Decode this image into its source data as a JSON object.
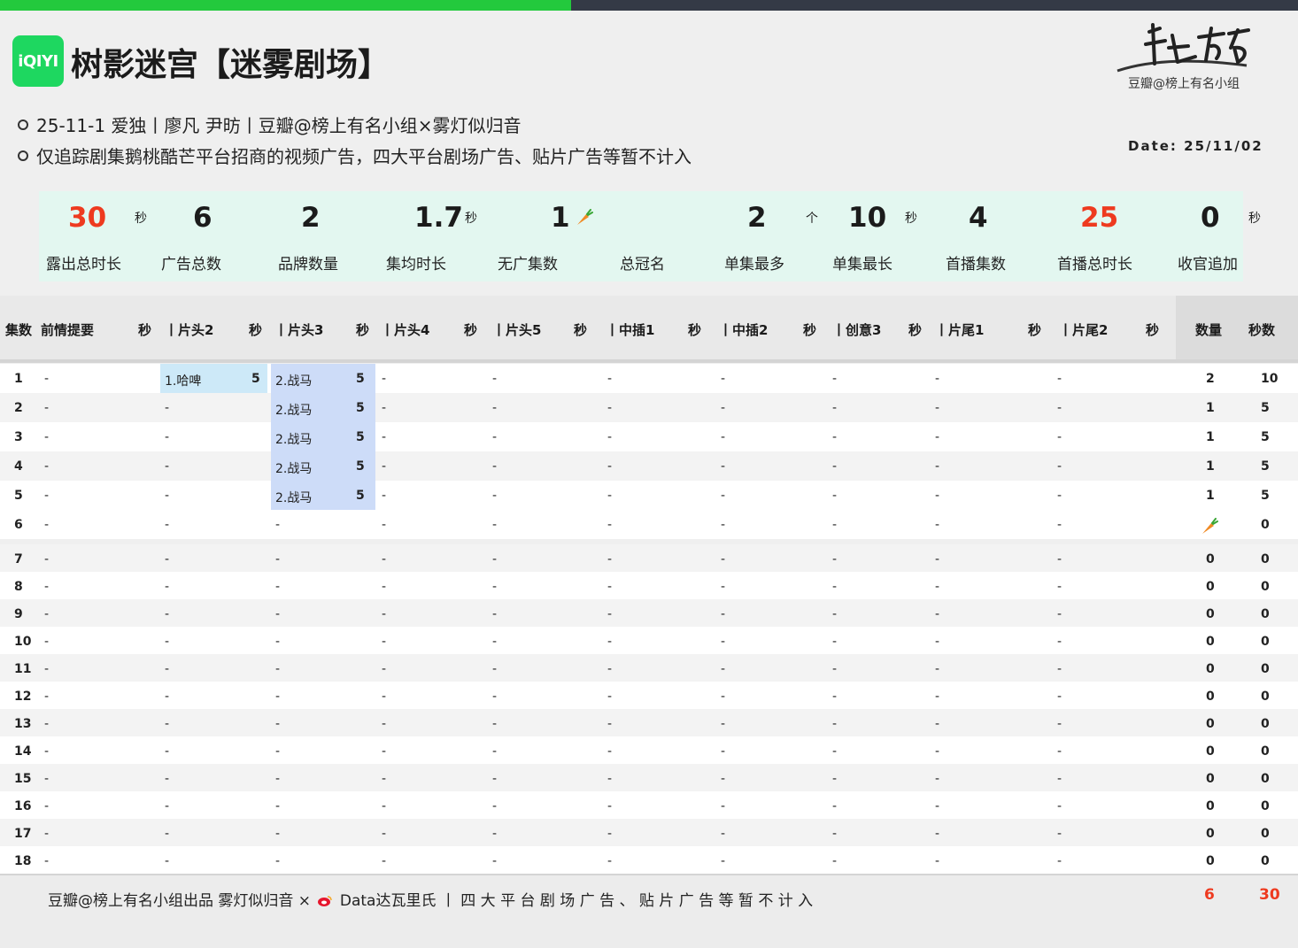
{
  "header": {
    "logo_text": "iQIYI",
    "title": "树影迷宫【迷雾剧场】",
    "brand_sub": "豆瓣@榜上有名小组",
    "bullets": [
      "25-11-1 爱独丨廖凡 尹昉丨豆瓣@榜上有名小组×雾灯似归音",
      "仅追踪剧集鹅桃酷芒平台招商的视频广告，四大平台剧场广告、贴片广告等暂不计入"
    ],
    "date": "Date: 25/11/02"
  },
  "colors": {
    "accent_green": "#23c93d",
    "highlight_red": "#ee3a1f",
    "stats_bg": "#e3f7f0"
  },
  "stats": [
    {
      "value": "30",
      "unit": "秒",
      "label": "露出总时长",
      "red": true
    },
    {
      "value": "6",
      "unit": "",
      "label": "广告总数"
    },
    {
      "value": "2",
      "unit": "",
      "label": "品牌数量"
    },
    {
      "value": "1.7",
      "unit": "秒",
      "label": "集均时长"
    },
    {
      "value": "1",
      "unit": "",
      "label": "无广集数",
      "icon": "carrot-icon"
    },
    {
      "value": "",
      "unit": "",
      "label": "总冠名"
    },
    {
      "value": "2",
      "unit": "个",
      "label": "单集最多"
    },
    {
      "value": "10",
      "unit": "秒",
      "label": "单集最长"
    },
    {
      "value": "4",
      "unit": "",
      "label": "首播集数"
    },
    {
      "value": "25",
      "unit": "",
      "label": "首播总时长",
      "red": true
    },
    {
      "value": "0",
      "unit": "秒",
      "label": "收官追加"
    }
  ],
  "table": {
    "headers": [
      "集数",
      "前情提要",
      "秒",
      "丨片头2",
      "秒",
      "丨片头3",
      "秒",
      "丨片头4",
      "秒",
      "丨片头5",
      "秒",
      "丨中插1",
      "秒",
      "丨中插2",
      "秒",
      "丨创意3",
      "秒",
      "丨片尾1",
      "秒",
      "丨片尾2",
      "秒",
      "数量",
      "秒数"
    ],
    "dash": "-",
    "rows": [
      {
        "ep": "1",
        "t2": "1.哈啤",
        "t2s": "5",
        "t3": "2.战马",
        "t3s": "5",
        "count": "2",
        "secs": "10"
      },
      {
        "ep": "2",
        "t2": "-",
        "t2s": "",
        "t3": "2.战马",
        "t3s": "5",
        "count": "1",
        "secs": "5"
      },
      {
        "ep": "3",
        "t2": "-",
        "t2s": "",
        "t3": "2.战马",
        "t3s": "5",
        "count": "1",
        "secs": "5"
      },
      {
        "ep": "4",
        "t2": "-",
        "t2s": "",
        "t3": "2.战马",
        "t3s": "5",
        "count": "1",
        "secs": "5"
      },
      {
        "ep": "5",
        "t2": "-",
        "t2s": "",
        "t3": "2.战马",
        "t3s": "5",
        "count": "1",
        "secs": "5"
      },
      {
        "ep": "6",
        "t2": "-",
        "t2s": "",
        "t3": "-",
        "t3s": "",
        "count": "",
        "count_icon": "carrot-icon",
        "secs": "0"
      },
      {
        "ep": "7",
        "t2": "-",
        "t2s": "",
        "t3": "-",
        "t3s": "",
        "count": "0",
        "secs": "0"
      },
      {
        "ep": "8",
        "t2": "-",
        "t2s": "",
        "t3": "-",
        "t3s": "",
        "count": "0",
        "secs": "0"
      },
      {
        "ep": "9",
        "t2": "-",
        "t2s": "",
        "t3": "-",
        "t3s": "",
        "count": "0",
        "secs": "0"
      },
      {
        "ep": "10",
        "t2": "-",
        "t2s": "",
        "t3": "-",
        "t3s": "",
        "count": "0",
        "secs": "0"
      },
      {
        "ep": "11",
        "t2": "-",
        "t2s": "",
        "t3": "-",
        "t3s": "",
        "count": "0",
        "secs": "0"
      },
      {
        "ep": "12",
        "t2": "-",
        "t2s": "",
        "t3": "-",
        "t3s": "",
        "count": "0",
        "secs": "0"
      },
      {
        "ep": "13",
        "t2": "-",
        "t2s": "",
        "t3": "-",
        "t3s": "",
        "count": "0",
        "secs": "0"
      },
      {
        "ep": "14",
        "t2": "-",
        "t2s": "",
        "t3": "-",
        "t3s": "",
        "count": "0",
        "secs": "0"
      },
      {
        "ep": "15",
        "t2": "-",
        "t2s": "",
        "t3": "-",
        "t3s": "",
        "count": "0",
        "secs": "0"
      },
      {
        "ep": "16",
        "t2": "-",
        "t2s": "",
        "t3": "-",
        "t3s": "",
        "count": "0",
        "secs": "0"
      },
      {
        "ep": "17",
        "t2": "-",
        "t2s": "",
        "t3": "-",
        "t3s": "",
        "count": "0",
        "secs": "0"
      },
      {
        "ep": "18",
        "t2": "-",
        "t2s": "",
        "t3": "-",
        "t3s": "",
        "count": "0",
        "secs": "0"
      }
    ]
  },
  "footer": {
    "text": "豆瓣@榜上有名小组出品  雾灯似归音 ×",
    "text2": "Data达瓦里氏 丨 四 大 平 台 剧 场 广 告 、 贴 片 广 告 等 暂 不 计 入",
    "total_count": "6",
    "total_secs": "30"
  }
}
